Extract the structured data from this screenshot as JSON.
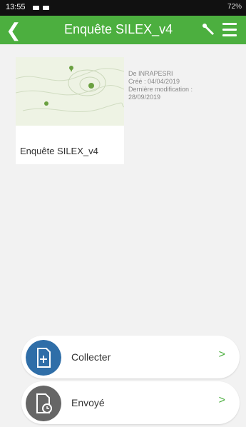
{
  "status": {
    "time": "13:55",
    "right_text": "72%"
  },
  "appbar": {
    "title": "Enquête SILEX_v4",
    "back_icon": "chevron-left-icon",
    "tool_icon": "wrench-icon",
    "menu_icon": "hamburger-menu-icon"
  },
  "survey": {
    "title": "Enquête SILEX_v4",
    "owner": "De INRAPESRI",
    "created": "Créé : 04/04/2019",
    "modified_label": "Dernière modification :",
    "modified_date": "28/09/2019"
  },
  "actions": [
    {
      "label": "Collecter",
      "icon": "add-document-icon",
      "chevron": ">",
      "color": "#2f6ea8"
    },
    {
      "label": "Envoyé",
      "icon": "sent-clock-icon",
      "chevron": ">",
      "color": "#666666"
    }
  ]
}
